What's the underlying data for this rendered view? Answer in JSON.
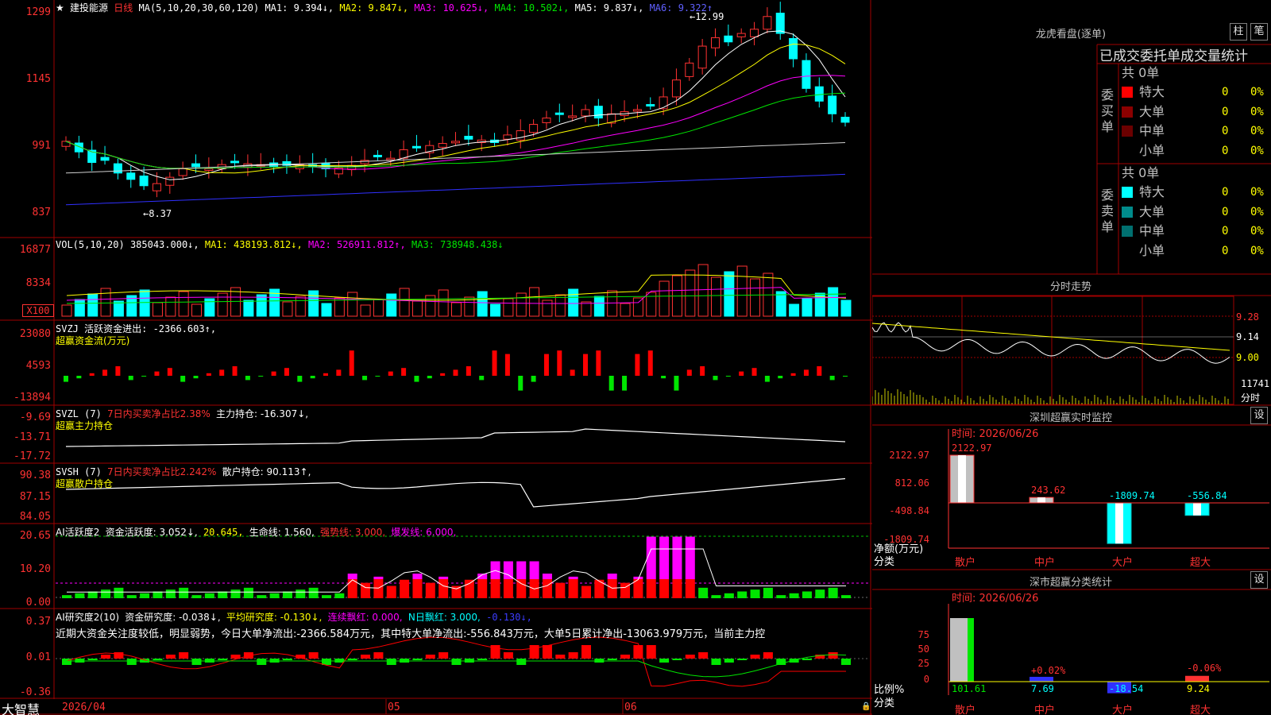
{
  "stock": {
    "name": "建投能源",
    "period": "日线",
    "ma_header": "MA(5,10,20,30,60,120)",
    "ma1": "MA1: 9.394↓,",
    "ma2": "MA2: 9.847↓,",
    "ma3": "MA3: 10.625↓,",
    "ma4": "MA4: 10.502↓,",
    "ma5": "MA5: 9.837↓,",
    "ma6": "MA6: 9.322↑",
    "y_labels": [
      "1299",
      "1145",
      "991",
      "837"
    ],
    "high_mark": "12.99",
    "low_mark": "8.37"
  },
  "vol": {
    "title": "VOL(5,10,20)",
    "value": "385043.000↓,",
    "ma1": "MA1: 438193.812↓,",
    "ma2": "MA2: 526911.812↑,",
    "ma3": "MA3: 738948.438↓",
    "y_labels": [
      "16877",
      "8334",
      "X100"
    ]
  },
  "svzj": {
    "title": "SVZJ  活跃资金进出: -2366.603↑,",
    "subtitle": "超赢资金流(万元)",
    "y_labels": [
      "23080",
      "4593",
      "-13894"
    ]
  },
  "svzl": {
    "name": "SVZL (7)",
    "desc": "7日内买卖净占比2.38%",
    "value": "主力持仓: -16.307↓,",
    "subtitle": "超赢主力持仓",
    "y_labels": [
      "-9.69",
      "-13.71",
      "-17.72"
    ]
  },
  "svsh": {
    "name": "SVSH (7)",
    "desc": "7日内买卖净占比2.242%",
    "value": "散户持仓: 90.113↑,",
    "subtitle": "超赢散户持仓",
    "y_labels": [
      "90.38",
      "87.15",
      "84.05"
    ]
  },
  "ai_active": {
    "title": "AI活跃度2",
    "value": "资金活跃度: 3.052↓,",
    "v2": "20.645,",
    "life": "生命线: 1.560,",
    "strong": "强势线: 3.000,",
    "burst": "爆发线: 6.000,",
    "y_labels": [
      "20.65",
      "10.20",
      "0.00"
    ]
  },
  "ai_research": {
    "title": "AI研究度2(10)",
    "value": "资金研究度: -0.038↓,",
    "avg": "平均研究度: -0.130↓,",
    "lxph": "连续飘红: 0.000,",
    "nph": "N日飘红: 3.000,",
    "last": "-0.130↓,",
    "commentary": "近期大资金关注度较低，明显弱势，今日大单净流出:-2366.584万元，其中特大单净流出:-556.843万元，大单5日累计净出-13063.979万元，当前主力控",
    "y_labels": [
      "0.37",
      "0.01",
      "-0.36"
    ]
  },
  "footer": {
    "brand": "大智慧",
    "date_start": "2026/04",
    "m1": "05",
    "m2": "06"
  },
  "longhu": {
    "title": "龙虎看盘(逐单)",
    "btn1": "柱",
    "btn2": "笔",
    "subtitle": "已成交委托单成交量统计",
    "buy_label": "委买单",
    "sell_label": "委卖单",
    "buy_total": "共 0单",
    "sell_total": "共 0单",
    "buy_rows": [
      {
        "label": "特大",
        "count": "0",
        "pct": "0%",
        "color": "#ff0000"
      },
      {
        "label": "大单",
        "count": "0",
        "pct": "0%",
        "color": "#8b0000"
      },
      {
        "label": "中单",
        "count": "0",
        "pct": "0%",
        "color": "#6b0000"
      },
      {
        "label": "小单",
        "count": "0",
        "pct": "0%",
        "color": ""
      }
    ],
    "sell_rows": [
      {
        "label": "特大",
        "count": "0",
        "pct": "0%",
        "color": "#00ffff"
      },
      {
        "label": "大单",
        "count": "0",
        "pct": "0%",
        "color": "#008b8b"
      },
      {
        "label": "中单",
        "count": "0",
        "pct": "0%",
        "color": "#007070"
      },
      {
        "label": "小单",
        "count": "0",
        "pct": "0%",
        "color": ""
      }
    ]
  },
  "intraday": {
    "title": "分时走势",
    "y_labels": [
      "9.28",
      "9.14",
      "9.00"
    ],
    "vol_label": "11741",
    "unit": "分时"
  },
  "sz_monitor": {
    "title": "深圳超赢实时监控",
    "settings": "设",
    "time": "时间: 2026/06/26",
    "y_labels": [
      "2122.97",
      "812.06",
      "-498.84",
      "-1809.74"
    ],
    "unit1": "净额(万元)",
    "unit2": "分类",
    "categories": [
      "散户",
      "中户",
      "大户",
      "超大"
    ],
    "values": [
      2122.97,
      243.62,
      -1809.74,
      -556.84
    ],
    "value_labels": [
      "2122.97",
      "243.62",
      "-1809.74",
      "-556.84"
    ]
  },
  "sz_class": {
    "title": "深市超赢分类统计",
    "settings": "设",
    "time": "时间: 2026/06/26",
    "y_labels": [
      "75",
      "50",
      "25",
      "0"
    ],
    "unit1": "比例%",
    "unit2": "分类",
    "categories": [
      "散户",
      "中户",
      "大户",
      "超大"
    ],
    "values": [
      101.61,
      7.69,
      -18.54,
      9.24
    ],
    "value_labels": [
      "101.61",
      "7.69",
      "-18.54",
      "9.24"
    ],
    "top_labels": [
      "",
      "+0.02%",
      "",
      "-0.06%"
    ]
  }
}
